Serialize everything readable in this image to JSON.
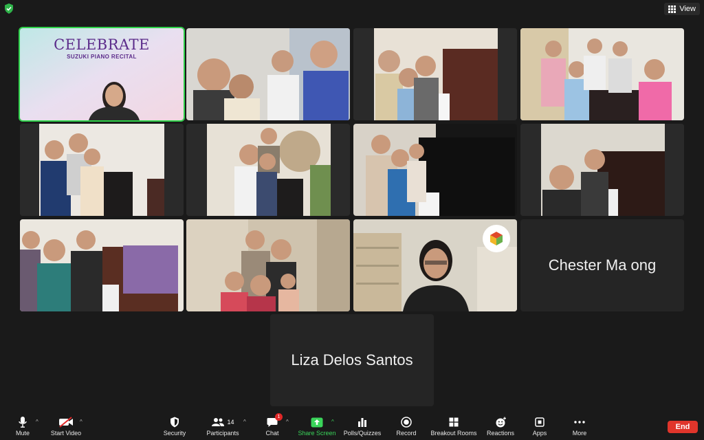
{
  "top": {
    "view_label": "View"
  },
  "tiles": [
    {
      "kind": "celebrate",
      "title": "CELEBRATE",
      "subtitle": "SUZUKI PIANO RECITAL",
      "active": true
    },
    {
      "kind": "video"
    },
    {
      "kind": "video"
    },
    {
      "kind": "video"
    },
    {
      "kind": "video"
    },
    {
      "kind": "video"
    },
    {
      "kind": "video"
    },
    {
      "kind": "video"
    },
    {
      "kind": "video"
    },
    {
      "kind": "video"
    },
    {
      "kind": "video",
      "logo": true
    },
    {
      "kind": "name",
      "name": "Chester Ma ong"
    }
  ],
  "last_tile": {
    "name": "Liza Delos Santos"
  },
  "toolbar": {
    "mute": "Mute",
    "start_video": "Start Video",
    "security": "Security",
    "participants": "Participants",
    "participants_count": "14",
    "chat": "Chat",
    "chat_badge": "1",
    "share_screen": "Share Screen",
    "polls": "Polls/Quizzes",
    "record": "Record",
    "breakout": "Breakout Rooms",
    "reactions": "Reactions",
    "apps": "Apps",
    "more": "More",
    "end": "End"
  },
  "colors": {
    "active_border": "#2fd24a",
    "share_green": "#3ad45a",
    "end_red": "#e0352b",
    "accent_purple": "#5b2b8a"
  }
}
